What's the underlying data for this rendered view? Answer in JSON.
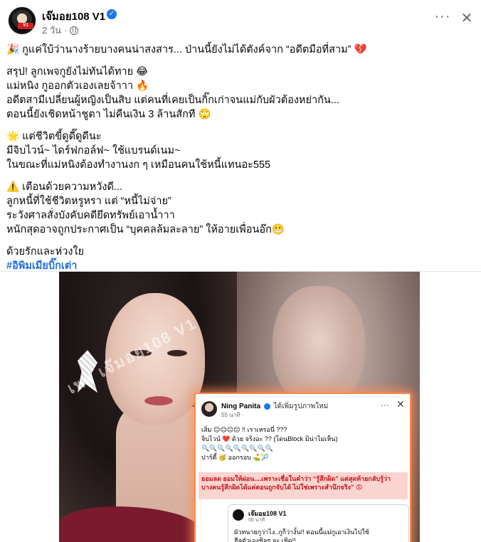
{
  "header": {
    "page_name": "เจ๊มอย108 V1",
    "time": "2 วัน",
    "dot": "·",
    "more_icon": "more-horizontal-icon",
    "close_icon": "close-icon"
  },
  "post": {
    "line1": "🎉 กูแค่ใบ้ว่านางร้ายบางคนน่าสงสาร... ป่านนี้ยังไม่ได้ตังค์จาก “อดีตมือที่สาม” 💔",
    "line2": "สรุป! ลูกเพจกูยังไม่ทันได้ทาย 😂",
    "line3": "แม่หนิง กูออกตัวเองเลยจ้าาา 🔥",
    "line4": "อดีตสามีเปลี่ยนผู้หญิงเป็นสิบ แต่คนที่เคยเป็นกิ๊กเก่าจนแม่กับผัวต้องหย่ากัน...",
    "line5": "ตอนนี้ยังเชิดหน้าชูตา ไม่คืนเงิน 3 ล้านสักที 🙄",
    "line6": "🌟 แต่ชีวิตขี้ดูดี๊ดูดีนะ",
    "line7": "มีจิบไวน์~ ไดร์ฟกอล์ฟ~ ใช้แบรนด์เนม~",
    "line8": "ในขณะที่แม่หนิงต้องทำงานงก ๆ เหมือนคนใช้หนี้แทนอะ555",
    "line9": "⚠️ เตือนด้วยความหวังดี...",
    "line10": "ลูกหนี้ที่ใช้ชีวิตหรูหรา แต่ “หนี้ไม่จ่าย”",
    "line11": "ระวังศาลสั่งบังคับคดียึดทรัพย์เอาน้ำาา",
    "line12": "หนักสุดอาจถูกประกาศเป็น “บุคคลล้มละลาย” ให้อายเพื่อนอ๊ก😬",
    "line13": "ด้วยรักและห่วงใย",
    "hashtag": "#อิพิมเมียบิ๊กเต่า"
  },
  "photo": {
    "watermark": "เพจ เจ๊มอย108 V1",
    "inset": {
      "name": "Ning Panita",
      "action": "ได้เพิ่มรูปภาพใหม่",
      "time": "55 นาที ·",
      "more": "···",
      "close": "✕",
      "body1": "เสิ่ม 😑😑😑😑 !! เราเหรอนี่ ???",
      "body2": "จิบไวน์ ❤️ ด้วย จริงอะ ?? (โดนBlock มิน่าไม่เห็น)",
      "body3": "🔍🔍🔍🔍🔍🔍🔍🔍🔍",
      "body4": "ปาร์ตี้ 🥳 ออกรอบ ⛳🎾",
      "highlight1": "ยอมลด ยอมให้ผ่อน....เพราะเชื่อในคำว่า “รู้สึกผิด” แต่สุดท้ายกลับรู้ว่า",
      "highlight2": "บางคนรู้สึกผิดได้แค่ตอนถูกจับได้ ไม่ใช่เพราะสำนึกจริง” 😡",
      "reply_name": "เจ๊มอย108 V1",
      "reply_time": "55 นาที",
      "reply1": "ผัวทนายกูว่าไง..กูก็ว่างั้น!! ตอนนี้แม่กูเอาเงินไปใช้",
      "reply2": "ฮีลตัวเองชิลๆ ละ เชิด!!"
    }
  }
}
